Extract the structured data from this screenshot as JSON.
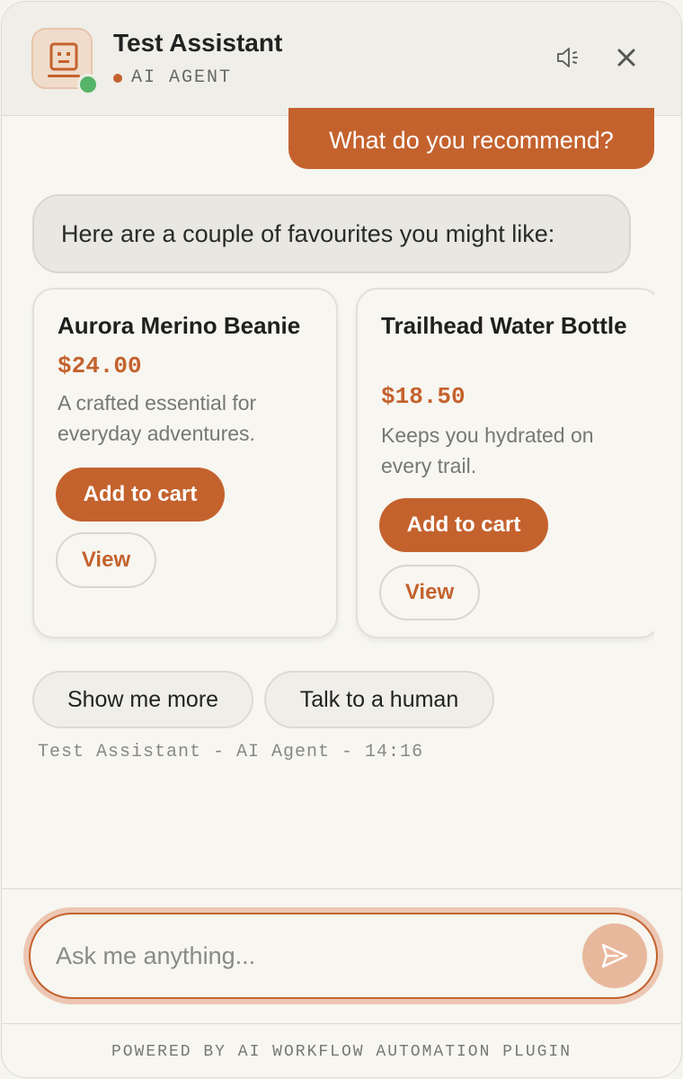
{
  "header": {
    "title": "Test Assistant",
    "subtitle": "AI AGENT",
    "avatar_icon": "robot-face-icon",
    "speaker_icon": "speaker-icon",
    "close_icon": "close-icon"
  },
  "messages": {
    "user_text": "What do you recommend?",
    "bot_text": "Here are a couple of favourites you might like:"
  },
  "products": [
    {
      "name": "Aurora Merino Beanie",
      "price": "$24.00",
      "description": "A crafted essential for everyday adventures.",
      "cart_label": "Add to cart",
      "view_label": "View"
    },
    {
      "name": "Trailhead Water Bottle",
      "price": "$18.50",
      "description": "Keeps you hydrated on every trail.",
      "cart_label": "Add to cart",
      "view_label": "View"
    }
  ],
  "quick_replies": [
    "Show me more",
    "Talk to a human"
  ],
  "meta_line": "Test Assistant - AI Agent - 14:16",
  "composer": {
    "placeholder": "Ask me anything...",
    "send_icon": "send-icon"
  },
  "footer": "POWERED BY AI WORKFLOW AUTOMATION PLUGIN",
  "colors": {
    "accent": "#c4622e",
    "online": "#55b467",
    "background": "#f7f6f0"
  }
}
